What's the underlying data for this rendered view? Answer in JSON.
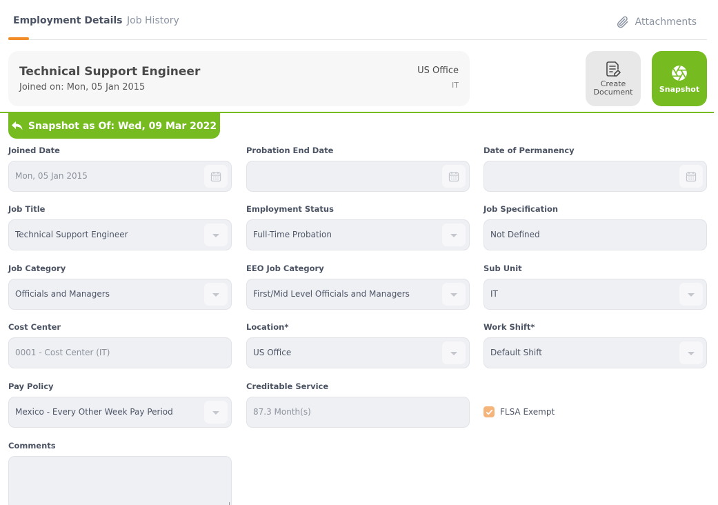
{
  "tabs": [
    {
      "label": "Employment Details",
      "active": true
    },
    {
      "label": "Job History",
      "active": false
    }
  ],
  "attachments": {
    "label": "Attachments",
    "icon": "paperclip-icon"
  },
  "employee": {
    "job_title": "Technical Support Engineer",
    "joined": "Joined on: Mon, 05 Jan 2015",
    "location": "US Office",
    "sub_unit": "IT"
  },
  "actions": {
    "create_document": "Create Document",
    "create_document_icon": "document-edit-icon",
    "snapshot": "Snapshot",
    "snapshot_icon": "aperture-icon"
  },
  "snapshot_banner": {
    "label": "Snapshot as Of: Wed, 09 Mar 2022",
    "icon": "reply-arrow-icon"
  },
  "fields": {
    "joined_date": {
      "label": "Joined Date",
      "value": "Mon, 05 Jan 2015",
      "icon": "calendar-icon"
    },
    "probation_end_date": {
      "label": "Probation End Date",
      "value": "",
      "icon": "calendar-icon"
    },
    "date_of_permanency": {
      "label": "Date of Permanency",
      "value": "",
      "icon": "calendar-icon"
    },
    "job_title": {
      "label": "Job Title",
      "value": "Technical Support Engineer",
      "icon": "chevron-down-icon"
    },
    "employment_status": {
      "label": "Employment Status",
      "value": "Full-Time Probation",
      "icon": "chevron-down-icon"
    },
    "job_specification": {
      "label": "Job Specification",
      "value": "Not Defined"
    },
    "job_category": {
      "label": "Job Category",
      "value": "Officials and Managers",
      "icon": "chevron-down-icon"
    },
    "eeo_job_category": {
      "label": "EEO Job Category",
      "value": "First/Mid Level Officials and Managers",
      "icon": "chevron-down-icon"
    },
    "sub_unit": {
      "label": "Sub Unit",
      "value": "IT",
      "icon": "chevron-down-icon"
    },
    "cost_center": {
      "label": "Cost Center",
      "value": "0001 - Cost Center (IT)"
    },
    "location": {
      "label": "Location*",
      "value": "US Office",
      "icon": "chevron-down-icon"
    },
    "work_shift": {
      "label": "Work Shift*",
      "value": "Default Shift",
      "icon": "chevron-down-icon"
    },
    "pay_policy": {
      "label": "Pay Policy",
      "value": "Mexico - Every Other Week Pay Period",
      "icon": "chevron-down-icon"
    },
    "creditable_service": {
      "label": "Creditable Service",
      "value": "87.3 Month(s)"
    },
    "flsa_exempt": {
      "label": "FLSA Exempt",
      "checked": true
    },
    "comments": {
      "label": "Comments",
      "value": ""
    }
  },
  "colors": {
    "accent_green": "#76bc21",
    "tab_underline": "#f28c28",
    "checkbox": "#f5b47a"
  }
}
